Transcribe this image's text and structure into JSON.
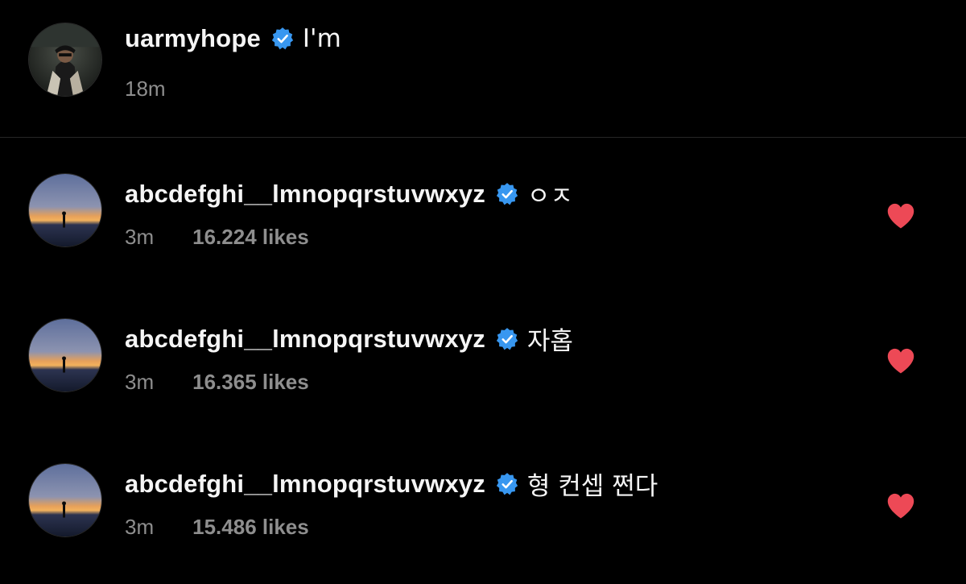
{
  "post": {
    "username": "uarmyhope",
    "verified": true,
    "caption": "I'm",
    "time": "18m",
    "avatar_icon": "profile-photo"
  },
  "comments": [
    {
      "username": "abcdefghi__lmnopqrstuvwxyz",
      "verified": true,
      "text": "ㅇㅈ",
      "time": "3m",
      "likes": "16.224 likes",
      "liked": true,
      "avatar_icon": "sunset-silhouette-photo"
    },
    {
      "username": "abcdefghi__lmnopqrstuvwxyz",
      "verified": true,
      "text": "자홉",
      "time": "3m",
      "likes": "16.365 likes",
      "liked": true,
      "avatar_icon": "sunset-silhouette-photo"
    },
    {
      "username": "abcdefghi__lmnopqrstuvwxyz",
      "verified": true,
      "text": "형 컨셉 쩐다",
      "time": "3m",
      "likes": "15.486 likes",
      "liked": true,
      "avatar_icon": "sunset-silhouette-photo"
    }
  ],
  "colors": {
    "background": "#000000",
    "text_primary": "#f5f5f5",
    "text_secondary": "#8e8e8e",
    "verified_blue": "#3897f0",
    "heart_red": "#ed4956"
  },
  "icons": {
    "verified": "verified-badge-icon",
    "like": "heart-icon"
  }
}
